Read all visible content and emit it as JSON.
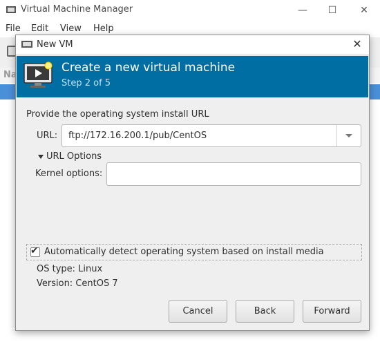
{
  "main_window": {
    "title": "Virtual Machine Manager",
    "menus": [
      "File",
      "Edit",
      "View",
      "Help"
    ],
    "list_header_partial": "Na",
    "controls": {
      "minimize": "—",
      "maximize": "☐",
      "close": "✕"
    }
  },
  "dialog": {
    "title": "New VM",
    "close_glyph": "✕",
    "banner": {
      "title": "Create a new virtual machine",
      "step": "Step 2 of 5"
    },
    "section_label": "Provide the operating system install URL",
    "url": {
      "label": "URL:",
      "value": "ftp://172.16.200.1/pub/CentOS"
    },
    "url_options": {
      "label": "URL Options",
      "expanded": true
    },
    "kernel": {
      "label": "Kernel options:",
      "value": ""
    },
    "detect": {
      "label": "Automatically detect operating system based on install media",
      "checked": true
    },
    "os_type": {
      "label": "OS type:",
      "value": "Linux",
      "text": "OS type:  Linux"
    },
    "os_version": {
      "label": "Version:",
      "value": "CentOS 7",
      "text": "Version:  CentOS 7"
    },
    "buttons": {
      "cancel": "Cancel",
      "back": "Back",
      "forward": "Forward"
    }
  },
  "colors": {
    "banner": "#006ea3",
    "selection": "#4a90d9"
  }
}
